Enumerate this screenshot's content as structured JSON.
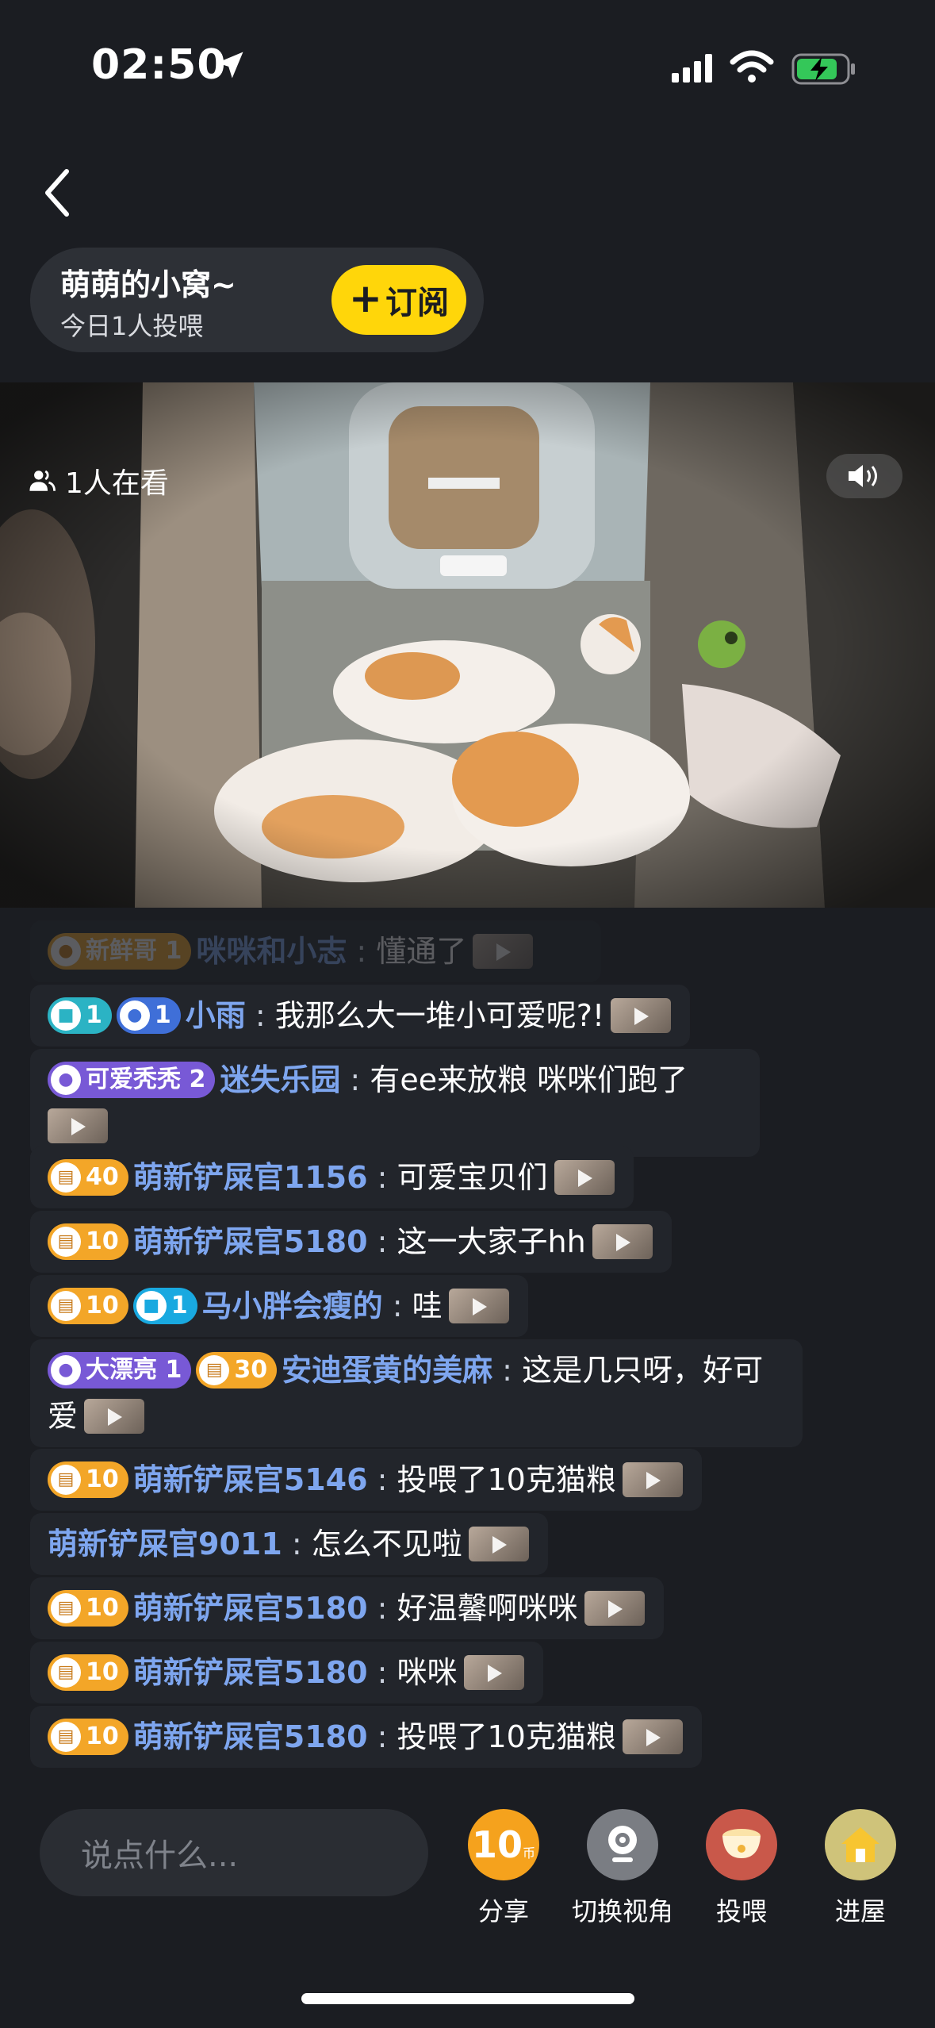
{
  "status": {
    "time": "02:50"
  },
  "room": {
    "name": "萌萌的小窝~",
    "subtitle": "今日1人投喂",
    "subscribe_label": "订阅"
  },
  "video": {
    "viewers": "1人在看"
  },
  "chat": [
    {
      "badges": [
        {
          "type": "orange",
          "level": "1",
          "text": "新鲜哥"
        }
      ],
      "user": "咪咪和小志",
      "text": "懂通了",
      "faded": true
    },
    {
      "badges": [
        {
          "type": "teal",
          "level": "1"
        },
        {
          "type": "blue",
          "level": "1"
        }
      ],
      "user": "小雨",
      "text": "我那么大一堆小可爱呢?!"
    },
    {
      "badges": [
        {
          "type": "purple",
          "level": "2",
          "text": "可爱秃秃"
        }
      ],
      "user": "迷失乐园",
      "text": "有ee来放粮 咪咪们跑了"
    },
    {
      "badges": [
        {
          "type": "orange",
          "level": "40"
        }
      ],
      "user": "萌新铲屎官1156",
      "text": "可爱宝贝们"
    },
    {
      "badges": [
        {
          "type": "orange",
          "level": "10"
        }
      ],
      "user": "萌新铲屎官5180",
      "text": "这一大家子hh"
    },
    {
      "badges": [
        {
          "type": "orange",
          "level": "10"
        },
        {
          "type": "cyan",
          "level": "1"
        }
      ],
      "user": "马小胖会瘦的",
      "text": "哇"
    },
    {
      "badges": [
        {
          "type": "purple",
          "level": "1",
          "text": "大漂亮"
        },
        {
          "type": "orange",
          "level": "30"
        }
      ],
      "user": "安迪蛋黄的美麻",
      "text": "这是几只呀，好可爱"
    },
    {
      "badges": [
        {
          "type": "orange",
          "level": "10"
        }
      ],
      "user": "萌新铲屎官5146",
      "text": "投喂了10克猫粮"
    },
    {
      "badges": [],
      "user": "萌新铲屎官9011",
      "text": "怎么不见啦"
    },
    {
      "badges": [
        {
          "type": "orange",
          "level": "10"
        }
      ],
      "user": "萌新铲屎官5180",
      "text": "好温馨啊咪咪"
    },
    {
      "badges": [
        {
          "type": "orange",
          "level": "10"
        }
      ],
      "user": "萌新铲屎官5180",
      "text": "咪咪"
    },
    {
      "badges": [
        {
          "type": "orange",
          "level": "10"
        }
      ],
      "user": "萌新铲屎官5180",
      "text": "投喂了10克猫粮"
    }
  ],
  "bottom": {
    "input_placeholder": "说点什么...",
    "actions": [
      {
        "label": "分享",
        "icon": "coin-10-icon",
        "value": "10"
      },
      {
        "label": "切换视角",
        "icon": "camera-icon"
      },
      {
        "label": "投喂",
        "icon": "food-bowl-icon"
      },
      {
        "label": "进屋",
        "icon": "house-icon"
      }
    ]
  }
}
